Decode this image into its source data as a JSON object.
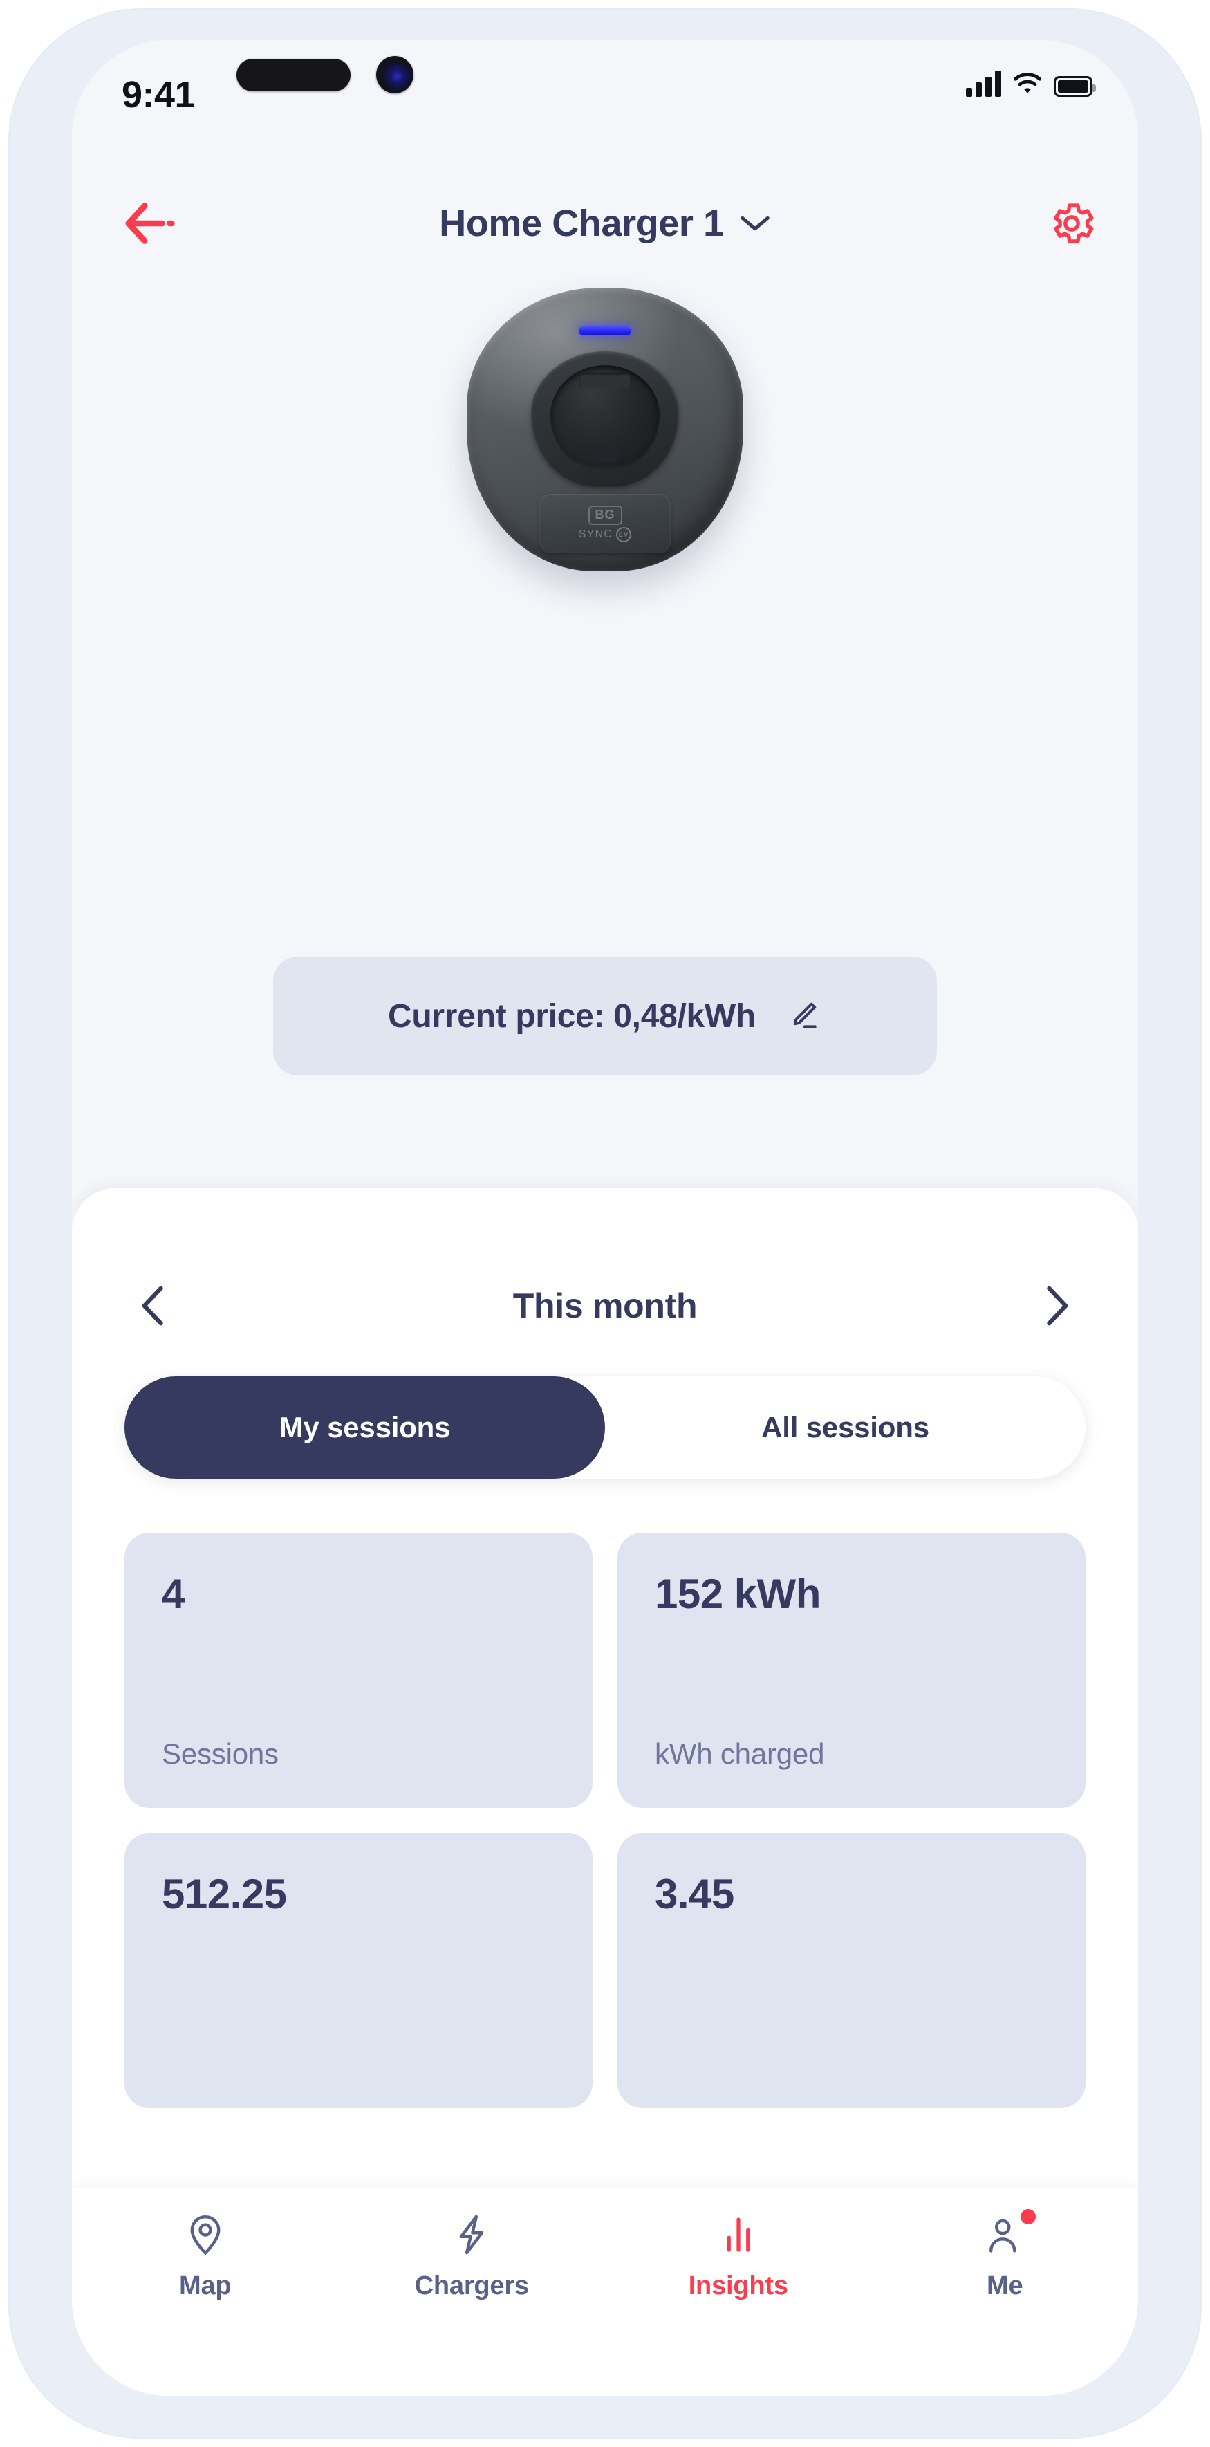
{
  "status_bar": {
    "time": "9:41",
    "cellular_icon": "cellular-bars-icon",
    "wifi_icon": "wifi-icon",
    "battery_icon": "battery-full-icon"
  },
  "header": {
    "back_icon": "back-arrow-icon",
    "title": "Home Charger 1",
    "dropdown_icon": "chevron-down-icon",
    "settings_icon": "gear-icon"
  },
  "hero": {
    "device_name": "BG SYNC EV charger",
    "brand_mark": "BG",
    "brand_sub": "SYNC",
    "brand_ev": "EV",
    "led_status_color": "#2626f0"
  },
  "price": {
    "label": "Current price: 0,48/kWh",
    "edit_icon": "pencil-edit-icon"
  },
  "period": {
    "prev_icon": "chevron-left-icon",
    "label": "This month",
    "next_icon": "chevron-right-icon"
  },
  "segmented": {
    "options": [
      {
        "label": "My sessions",
        "active": true
      },
      {
        "label": "All sessions",
        "active": false
      }
    ]
  },
  "stats": [
    {
      "value": "4",
      "caption": "Sessions"
    },
    {
      "value": "152 kWh",
      "caption": "kWh charged"
    },
    {
      "value": "512.25",
      "caption": ""
    },
    {
      "value": "3.45",
      "caption": ""
    }
  ],
  "tabbar": {
    "items": [
      {
        "label": "Map",
        "icon": "map-pin-icon",
        "active": false,
        "badge": false
      },
      {
        "label": "Chargers",
        "icon": "lightning-bolt-icon",
        "active": false,
        "badge": false
      },
      {
        "label": "Insights",
        "icon": "bar-chart-icon",
        "active": true,
        "badge": false
      },
      {
        "label": "Me",
        "icon": "person-icon",
        "active": false,
        "badge": true
      }
    ]
  },
  "colors": {
    "accent_red": "#fb3b4e",
    "ink_navy": "#363a5e",
    "muted": "#70769a",
    "card_bg": "#dfe4f0",
    "screen_bg": "#f4f6fa",
    "bezel": "#eaeff7"
  }
}
